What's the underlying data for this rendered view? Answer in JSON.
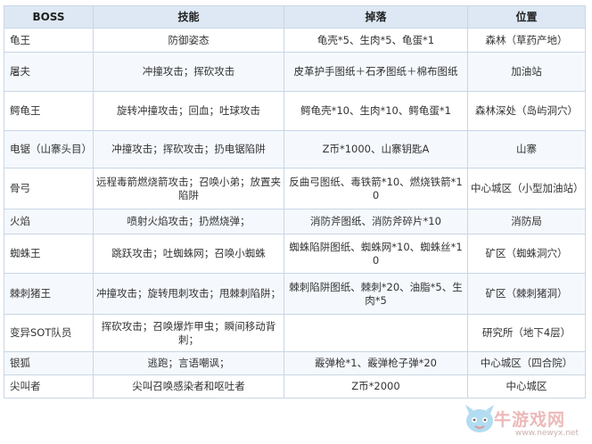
{
  "headers": [
    "BOSS",
    "技能",
    "掉落",
    "位置"
  ],
  "rows": [
    {
      "boss": "龟王",
      "skills": "防御姿态",
      "drops": "龟壳*5、生肉*5、龟蛋*1",
      "location": "森林（草药产地）"
    },
    {
      "boss": "屠夫",
      "skills": "冲撞攻击；挥砍攻击",
      "drops": "皮革护手图纸＋石矛图纸＋棉布图纸",
      "location": "加油站"
    },
    {
      "boss": "鳄龟王",
      "skills": "旋转冲撞攻击；回血；吐球攻击",
      "drops": "鳄龟壳*10、生肉*10、鳄龟蛋*1",
      "location": "森林深处（岛屿洞穴）"
    },
    {
      "boss": "电锯（山寨头目）",
      "skills": "冲撞攻击；挥砍攻击；扔电锯陷阱",
      "drops": "Z币*1000、山寨钥匙A",
      "location": "山寨"
    },
    {
      "boss": "骨弓",
      "skills": "远程毒箭燃烧箭攻击；召唤小弟；放置夹陷阱",
      "drops": "反曲弓图纸、毒铁箭*10、燃烧铁箭*10",
      "location": "中心城区（小型加油站）"
    },
    {
      "boss": "火焰",
      "skills": "喷射火焰攻击；扔燃烧弹；",
      "drops": "消防斧图纸、消防斧碎片*10",
      "location": "消防局"
    },
    {
      "boss": "蜘蛛王",
      "skills": "跳跃攻击；吐蜘蛛网；召唤小蜘蛛",
      "drops": "蜘蛛陷阱图纸、蜘蛛网*10、蜘蛛丝*10",
      "location": "矿区（蜘蛛洞穴）"
    },
    {
      "boss": "棘刺猪王",
      "skills": "冲撞攻击；旋转甩刺攻击；甩棘刺陷阱；",
      "drops": "棘刺陷阱图纸、棘刺*20、油脂*5、生肉*5",
      "location": "矿区（棘刺猪洞）"
    },
    {
      "boss": "变异SOT队员",
      "skills": "挥砍攻击；召唤爆炸甲虫；瞬间移动背刺；",
      "drops": "",
      "location": "研究所（地下4层）"
    },
    {
      "boss": "银狐",
      "skills": "逃跑；言语嘲讽；",
      "drops": "霰弹枪*1、霰弹枪子弹*20",
      "location": "中心城区（四合院）"
    },
    {
      "boss": "尖叫者",
      "skills": "尖叫召唤感染者和呕吐者",
      "drops": "Z币*2000",
      "location": "中心城区"
    }
  ],
  "watermark": {
    "text": "牛游戏网",
    "url": "www.newyx.net"
  }
}
